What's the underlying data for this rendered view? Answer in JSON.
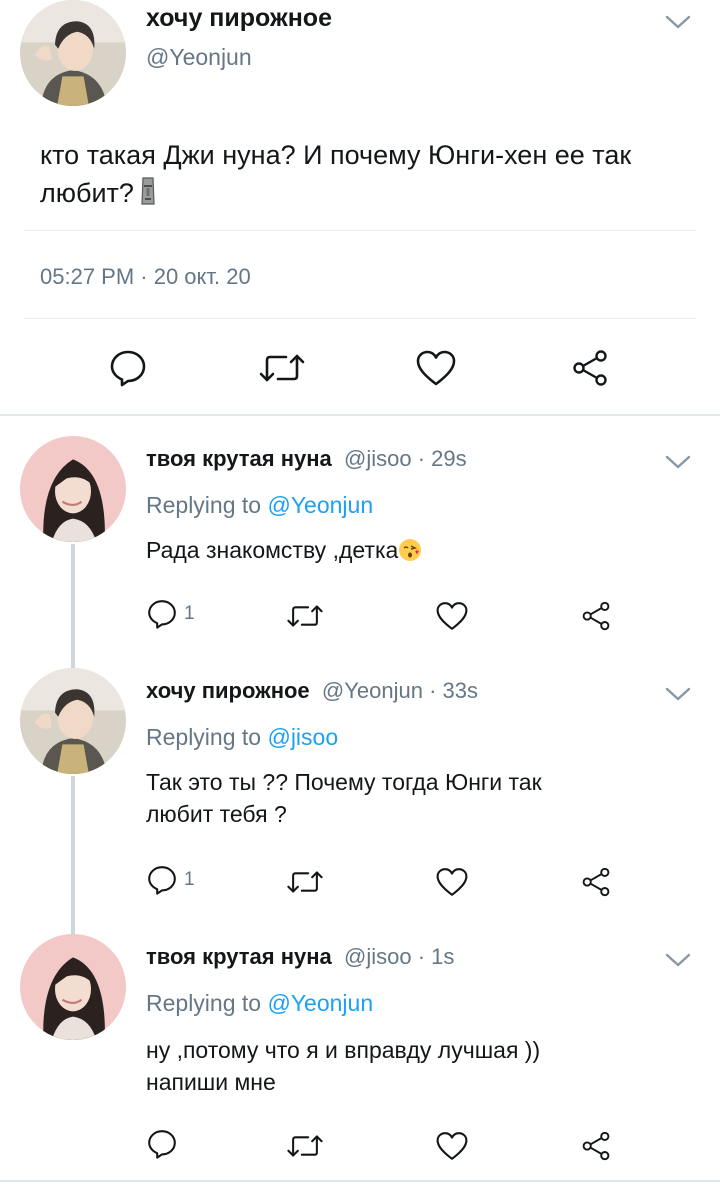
{
  "main_tweet": {
    "author_name": "хочу пирожное",
    "author_handle": "@Yeonjun",
    "text": "кто такая Джи нуна? И почему Юнги-хен ее так любит?",
    "emoji": "moai-icon",
    "timestamp": "05:27 PM · 20 окт. 20"
  },
  "replies": [
    {
      "author_name": "твоя крутая нуна",
      "meta": "@jisoo · 29s",
      "replying_label": "Replying to",
      "replying_to": "@Yeonjun",
      "text": "Рада знакомству ,детка",
      "emoji": "kissing-heart-face-icon",
      "reply_count": "1"
    },
    {
      "author_name": "хочу пирожное",
      "meta": "@Yeonjun · 33s",
      "replying_label": "Replying to",
      "replying_to": "@jisoo",
      "text_lines": [
        "Так это ты ?? Почему тогда Юнги так",
        "любит тебя ?"
      ],
      "reply_count": "1"
    },
    {
      "author_name": "твоя крутая нуна",
      "meta": "@jisoo · 1s",
      "replying_label": "Replying to",
      "replying_to": "@Yeonjun",
      "text_lines": [
        "ну ,потому что я и вправду лучшая ))",
        "напиши мне"
      ],
      "reply_count": ""
    }
  ],
  "colors": {
    "text": "#14171a",
    "secondary": "#657786",
    "link": "#1da1f2",
    "divider": "#e6ecf0",
    "thread_line": "#ccd6dd"
  }
}
